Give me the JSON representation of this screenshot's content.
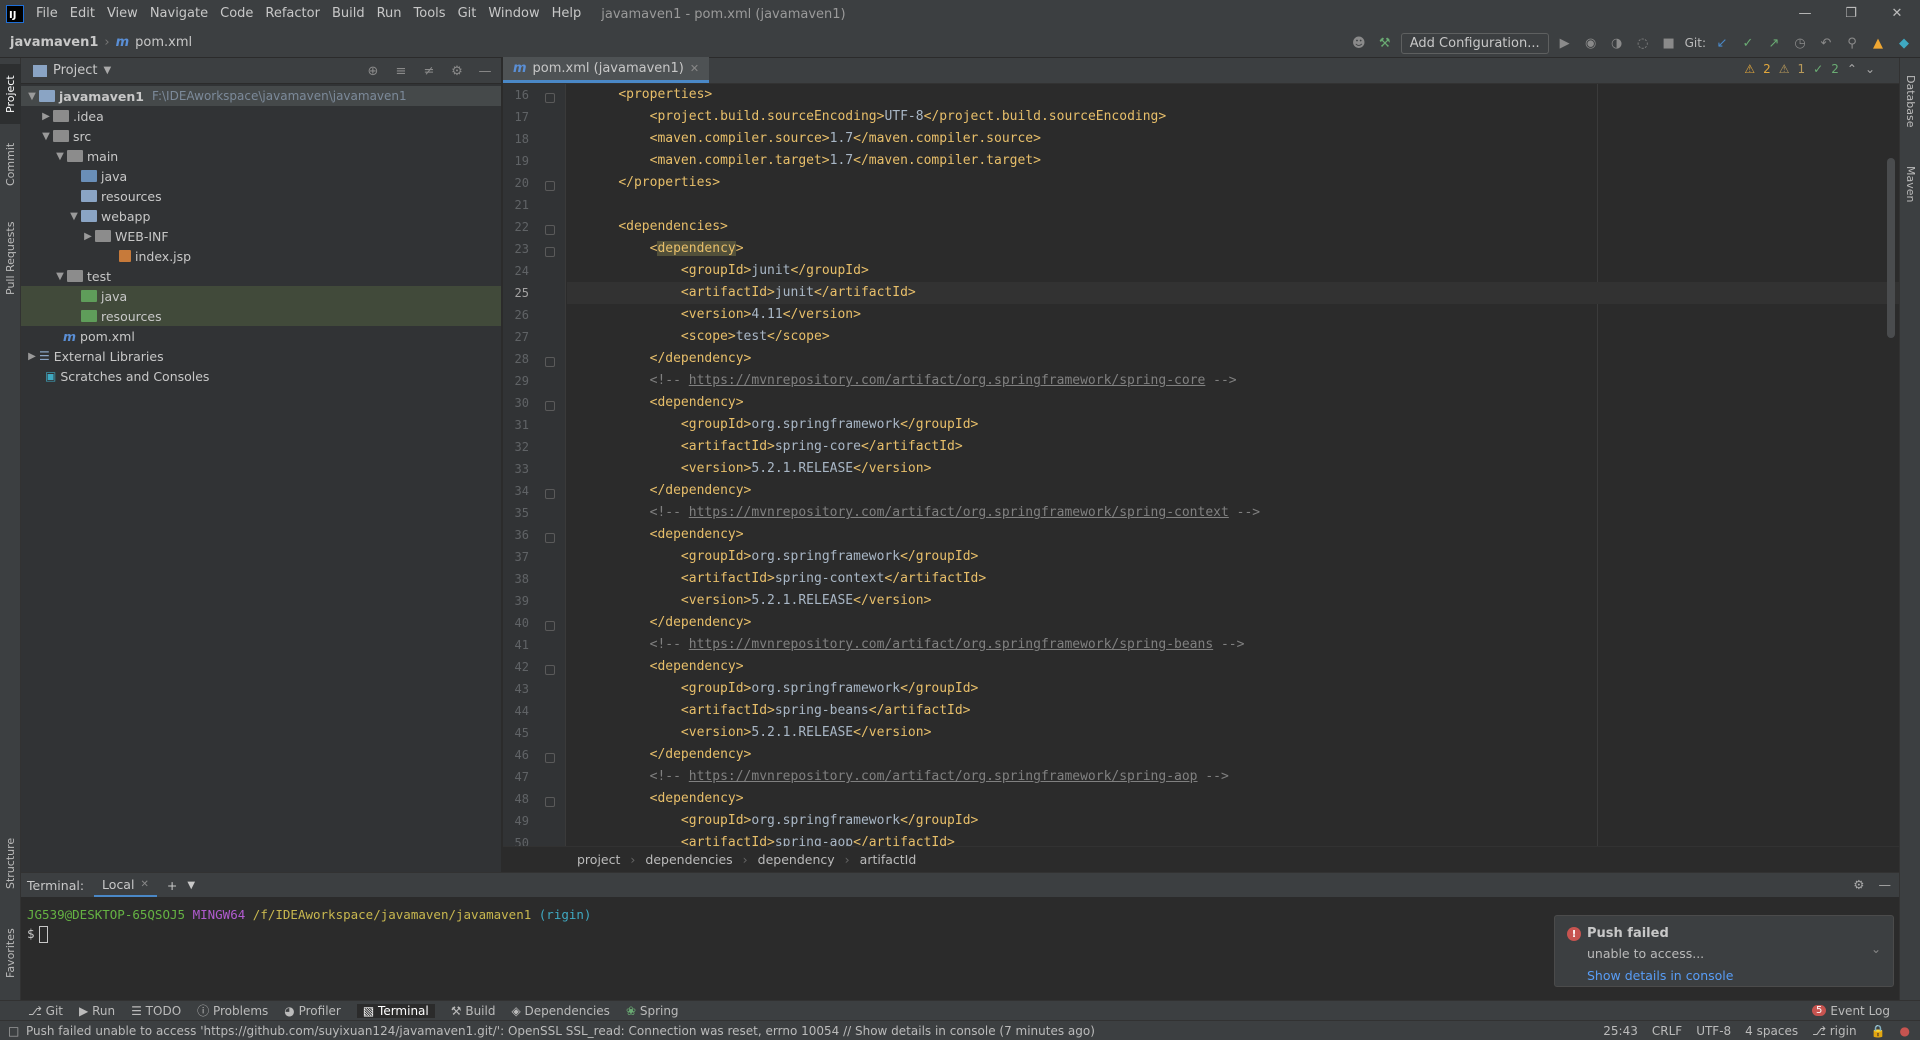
{
  "menubar": {
    "logo": "IJ",
    "items": [
      "File",
      "Edit",
      "View",
      "Navigate",
      "Code",
      "Refactor",
      "Build",
      "Run",
      "Tools",
      "Git",
      "Window",
      "Help"
    ],
    "window_title": "javamaven1 - pom.xml (javamaven1)"
  },
  "navbar": {
    "project": "javamaven1",
    "file_icon": "m",
    "file": "pom.xml",
    "add_config": "Add Configuration...",
    "git_label": "Git:"
  },
  "left_strip": {
    "tabs": [
      "Project",
      "Commit",
      "Pull Requests",
      "Structure",
      "Favorites"
    ]
  },
  "right_strip": {
    "tabs": [
      "Database",
      "Maven"
    ]
  },
  "project_panel": {
    "title": "Project",
    "tree": [
      {
        "label": "javamaven1",
        "path": "F:\\IDEAworkspace\\javamaven\\javamaven1"
      },
      {
        "label": ".idea"
      },
      {
        "label": "src"
      },
      {
        "label": "main"
      },
      {
        "label": "java"
      },
      {
        "label": "resources"
      },
      {
        "label": "webapp"
      },
      {
        "label": "WEB-INF"
      },
      {
        "label": "index.jsp"
      },
      {
        "label": "test"
      },
      {
        "label": "java"
      },
      {
        "label": "resources"
      },
      {
        "label": "pom.xml"
      },
      {
        "label": "External Libraries"
      },
      {
        "label": "Scratches and Consoles"
      }
    ]
  },
  "editor": {
    "tab_label": "pom.xml (javamaven1)",
    "tab_icon": "m",
    "inspections": {
      "warnings": "2",
      "weak_warnings": "1",
      "ok": "2"
    },
    "line_numbers": [
      "16",
      "17",
      "18",
      "19",
      "20",
      "21",
      "22",
      "23",
      "24",
      "25",
      "26",
      "27",
      "28",
      "29",
      "30",
      "31",
      "32",
      "33",
      "34",
      "35",
      "36",
      "37",
      "38",
      "39",
      "40",
      "41",
      "42",
      "43",
      "44",
      "45",
      "46",
      "47",
      "48",
      "49",
      "50"
    ],
    "current_line": "25",
    "lines": [
      "    <properties>",
      "        <project.build.sourceEncoding>UTF-8</project.build.sourceEncoding>",
      "        <maven.compiler.source>1.7</maven.compiler.source>",
      "        <maven.compiler.target>1.7</maven.compiler.target>",
      "    </properties>",
      "",
      "    <dependencies>",
      "        <dependency>",
      "            <groupId>junit</groupId>",
      "            <artifactId>junit</artifactId>",
      "            <version>4.11</version>",
      "            <scope>test</scope>",
      "        </dependency>",
      "        <!-- https://mvnrepository.com/artifact/org.springframework/spring-core -->",
      "        <dependency>",
      "            <groupId>org.springframework</groupId>",
      "            <artifactId>spring-core</artifactId>",
      "            <version>5.2.1.RELEASE</version>",
      "        </dependency>",
      "        <!-- https://mvnrepository.com/artifact/org.springframework/spring-context -->",
      "        <dependency>",
      "            <groupId>org.springframework</groupId>",
      "            <artifactId>spring-context</artifactId>",
      "            <version>5.2.1.RELEASE</version>",
      "        </dependency>",
      "        <!-- https://mvnrepository.com/artifact/org.springframework/spring-beans -->",
      "        <dependency>",
      "            <groupId>org.springframework</groupId>",
      "            <artifactId>spring-beans</artifactId>",
      "            <version>5.2.1.RELEASE</version>",
      "        </dependency>",
      "        <!-- https://mvnrepository.com/artifact/org.springframework/spring-aop -->",
      "        <dependency>",
      "            <groupId>org.springframework</groupId>",
      "            <artifactId>spring-aop</artifactId>"
    ],
    "breadcrumb": [
      "project",
      "dependencies",
      "dependency",
      "artifactId"
    ]
  },
  "terminal": {
    "label": "Terminal:",
    "tab": "Local",
    "prompt_user": "JG539@DESKTOP-65QSOJ5",
    "prompt_host": "MINGW64",
    "prompt_path": "/f/IDEAworkspace/javamaven/javamaven1",
    "prompt_branch": "(rigin)",
    "prompt_symbol": "$"
  },
  "notification": {
    "title": "Push failed",
    "body": "unable to access...",
    "link": "Show details in console"
  },
  "bottom_tabs": [
    "Git",
    "Run",
    "TODO",
    "Problems",
    "Profiler",
    "Terminal",
    "Build",
    "Dependencies",
    "Spring"
  ],
  "active_bottom_tab": "Terminal",
  "event_log": "Event Log",
  "event_log_badge": "5",
  "status": {
    "message": "Push failed unable to access 'https://github.com/suyixuan124/javamaven1.git/': OpenSSL SSL_read: Connection was reset, errno 10054 // Show details in console (7 minutes ago)",
    "position": "25:43",
    "line_sep": "CRLF",
    "encoding": "UTF-8",
    "indent": "4 spaces",
    "branch": "rigin"
  },
  "colors": {
    "accent": "#4a88c7",
    "tag": "#e8bf6a",
    "text": "#a9b7c6",
    "comment": "#808080",
    "error": "#c75450"
  }
}
